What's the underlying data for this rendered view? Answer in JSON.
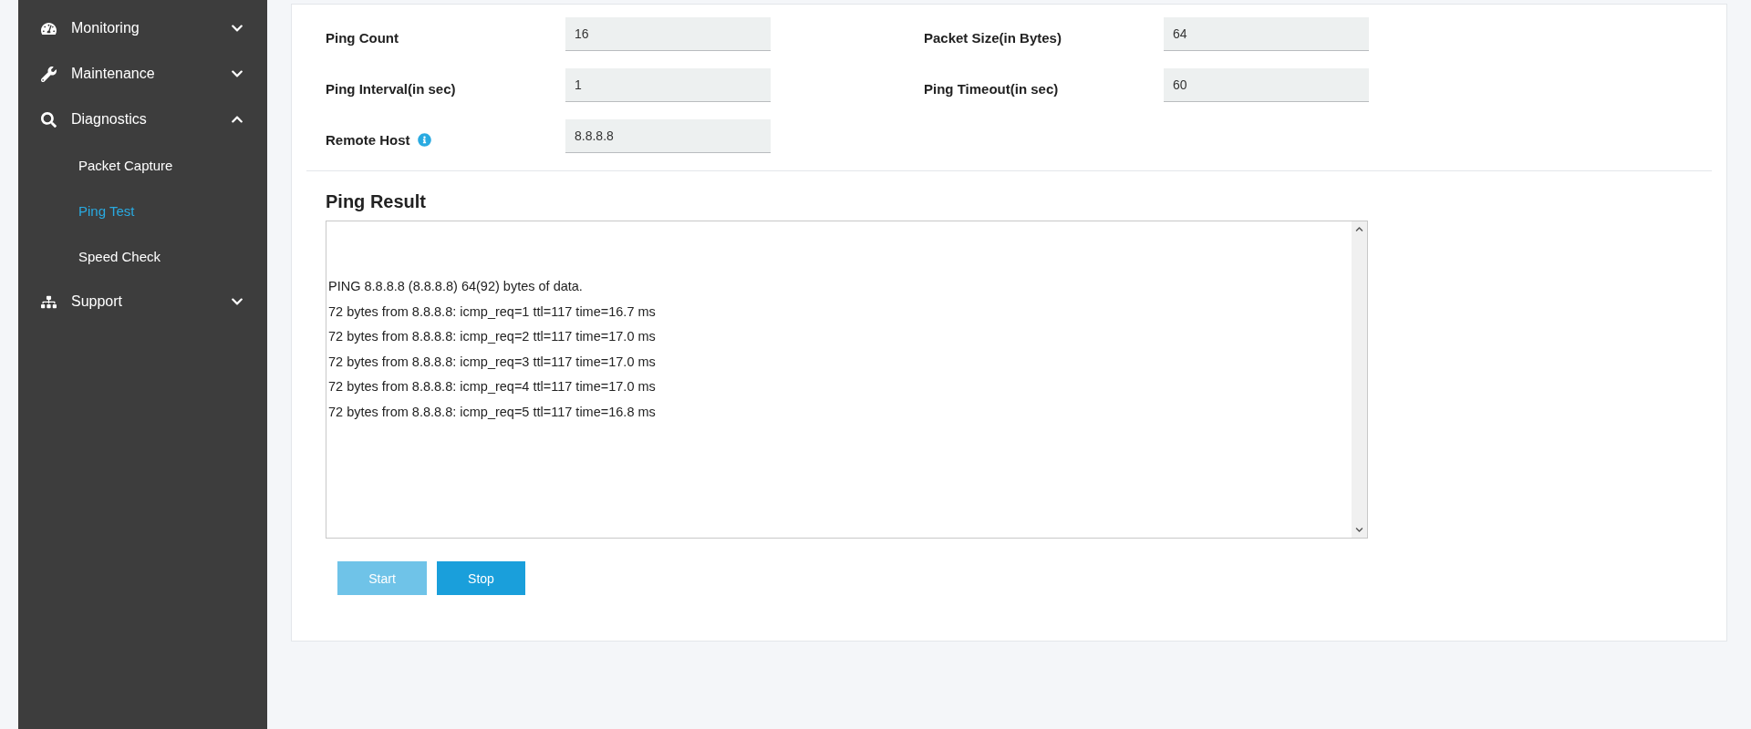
{
  "sidebar": {
    "items": [
      {
        "label": "Monitoring",
        "expanded": false
      },
      {
        "label": "Maintenance",
        "expanded": false
      },
      {
        "label": "Diagnostics",
        "expanded": true,
        "children": [
          {
            "label": "Packet Capture",
            "selected": false
          },
          {
            "label": "Ping Test",
            "selected": true
          },
          {
            "label": "Speed Check",
            "selected": false
          }
        ]
      },
      {
        "label": "Support",
        "expanded": false
      }
    ]
  },
  "form": {
    "fields": [
      {
        "label": "Ping Count",
        "value": "16",
        "info": false
      },
      {
        "label": "Packet Size(in Bytes)",
        "value": "64",
        "info": false
      },
      {
        "label": "Ping Interval(in sec)",
        "value": "1",
        "info": false
      },
      {
        "label": "Ping Timeout(in sec)",
        "value": "60",
        "info": false
      },
      {
        "label": "Remote Host",
        "value": "8.8.8.8",
        "info": true
      }
    ]
  },
  "result": {
    "title": "Ping Result",
    "lines": [
      "PING 8.8.8.8 (8.8.8.8) 64(92) bytes of data.",
      "72 bytes from 8.8.8.8: icmp_req=1 ttl=117 time=16.7 ms",
      "72 bytes from 8.8.8.8: icmp_req=2 ttl=117 time=17.0 ms",
      "72 bytes from 8.8.8.8: icmp_req=3 ttl=117 time=17.0 ms",
      "72 bytes from 8.8.8.8: icmp_req=4 ttl=117 time=17.0 ms",
      "72 bytes from 8.8.8.8: icmp_req=5 ttl=117 time=16.8 ms"
    ]
  },
  "buttons": [
    {
      "label": "Start",
      "disabled": true
    },
    {
      "label": "Stop",
      "disabled": false
    }
  ]
}
